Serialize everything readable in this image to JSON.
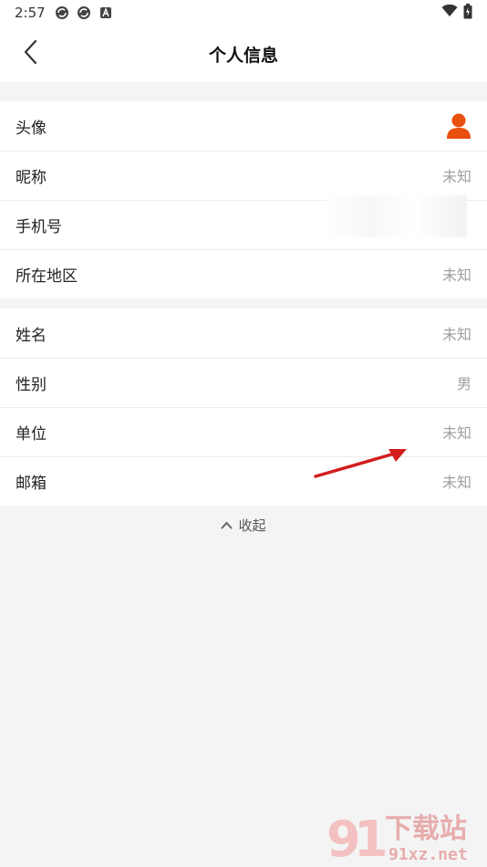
{
  "status_bar": {
    "time": "2:57",
    "icons": [
      "sync-icon",
      "sync-icon",
      "a-icon"
    ],
    "right_icons": [
      "wifi-icon",
      "battery-icon"
    ]
  },
  "header": {
    "title": "个人信息",
    "back_icon": "chevron-left-icon"
  },
  "section1": {
    "rows": [
      {
        "label": "头像",
        "value": ""
      },
      {
        "label": "昵称",
        "value": "未知"
      },
      {
        "label": "手机号",
        "value": ""
      },
      {
        "label": "所在地区",
        "value": "未知"
      }
    ]
  },
  "section2": {
    "rows": [
      {
        "label": "姓名",
        "value": "未知"
      },
      {
        "label": "性别",
        "value": "男"
      },
      {
        "label": "单位",
        "value": "未知"
      },
      {
        "label": "邮箱",
        "value": "未知"
      }
    ]
  },
  "collapse": {
    "label": "收起"
  },
  "watermark": {
    "text_top": "下载站",
    "text_bottom": "91xz.net"
  },
  "colors": {
    "accent": "#e8500e",
    "arrow": "#d31d1d",
    "value_gray": "#a0a0a0"
  }
}
